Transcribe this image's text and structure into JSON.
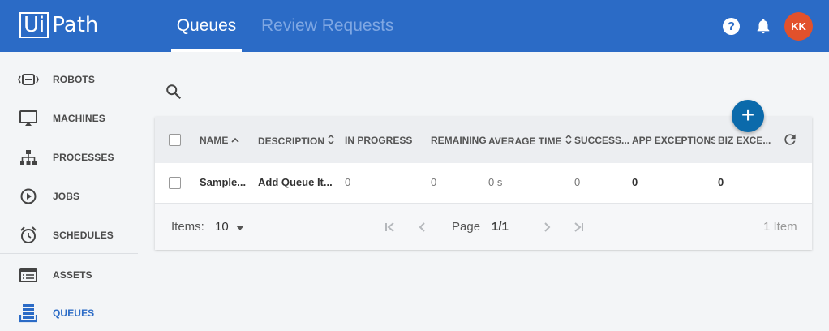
{
  "app": {
    "logo_ui": "Ui",
    "logo_path": "Path"
  },
  "header": {
    "tabs": [
      {
        "label": "Queues",
        "active": true
      },
      {
        "label": "Review Requests",
        "active": false
      }
    ],
    "help_glyph": "?",
    "avatar_initials": "KK"
  },
  "sidebar": {
    "items": [
      {
        "label": "ROBOTS",
        "icon": "robot-icon"
      },
      {
        "label": "MACHINES",
        "icon": "monitor-icon"
      },
      {
        "label": "PROCESSES",
        "icon": "process-icon"
      },
      {
        "label": "JOBS",
        "icon": "play-circle-icon"
      },
      {
        "label": "SCHEDULES",
        "icon": "alarm-clock-icon"
      },
      {
        "label": "ASSETS",
        "icon": "list-icon"
      },
      {
        "label": "QUEUES",
        "icon": "queue-icon",
        "active": true
      }
    ]
  },
  "colors": {
    "topbar": "#2b6bc6",
    "fab": "#0b6aab",
    "avatar": "#e2512b",
    "active_nav": "#2b6bc6"
  },
  "fab_label": "+",
  "table": {
    "columns": [
      {
        "label": "NAME",
        "sort": "asc"
      },
      {
        "label": "DESCRIPTION",
        "sort": "both"
      },
      {
        "label": "IN PROGRESS"
      },
      {
        "label": "REMAINING"
      },
      {
        "label": "AVERAGE TIME",
        "sort": "both"
      },
      {
        "label": "SUCCESS..."
      },
      {
        "label": "APP EXCEPTIONS"
      },
      {
        "label": "BIZ EXCE..."
      }
    ],
    "rows": [
      {
        "name": "Sample...",
        "description": "Add Queue It...",
        "in_progress": "0",
        "remaining": "0",
        "average_time": "0 s",
        "successful": "0",
        "app_exceptions": "0",
        "biz_exceptions": "0"
      }
    ]
  },
  "pager": {
    "items_label": "Items:",
    "page_size": "10",
    "page_label": "Page",
    "page_value": "1/1",
    "total": "1 Item"
  }
}
